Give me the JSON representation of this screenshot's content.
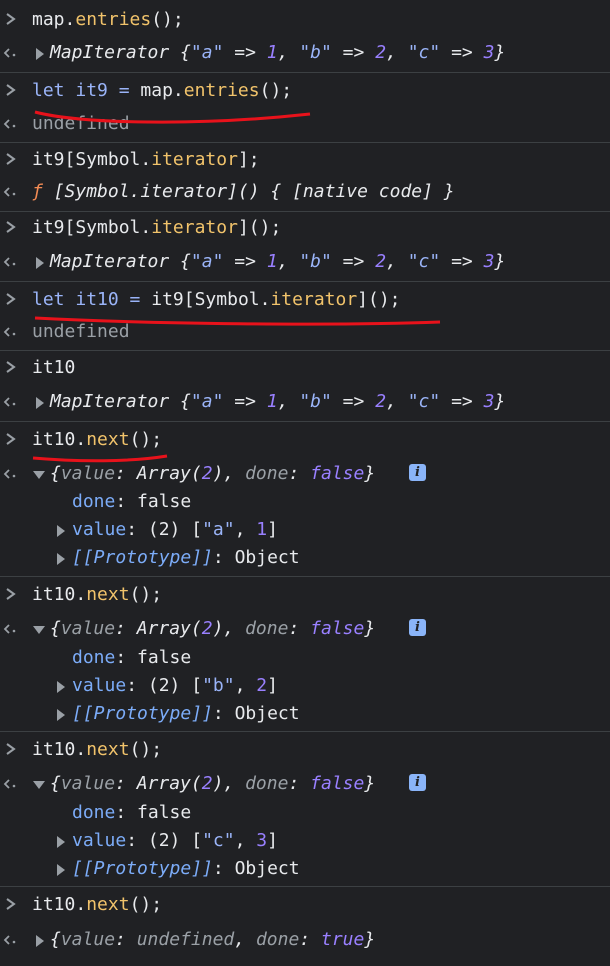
{
  "console": {
    "entries": [
      {
        "input": "map.entries();",
        "output": "MapIterator {\"a\" => 1, \"b\" => 2, \"c\" => 3}"
      },
      {
        "input": "let it9 = map.entries();",
        "output": "undefined"
      },
      {
        "input": "it9[Symbol.iterator];",
        "output": "ƒ [Symbol.iterator]() { [native code] }"
      },
      {
        "input": "it9[Symbol.iterator]();",
        "output": "MapIterator {\"a\" => 1, \"b\" => 2, \"c\" => 3}"
      },
      {
        "input": "let it10 = it9[Symbol.iterator]();",
        "output": "undefined"
      },
      {
        "input": "it10",
        "output": "MapIterator {\"a\" => 1, \"b\" => 2, \"c\" => 3}"
      },
      {
        "input": "it10.next();",
        "output": "{value: Array(2), done: false}",
        "expanded": [
          "done: false",
          "value: (2) [\"a\", 1]",
          "[[Prototype]]: Object"
        ]
      },
      {
        "input": "it10.next();",
        "output": "{value: Array(2), done: false}",
        "expanded": [
          "done: false",
          "value: (2) [\"b\", 2]",
          "[[Prototype]]: Object"
        ]
      },
      {
        "input": "it10.next();",
        "output": "{value: Array(2), done: false}",
        "expanded": [
          "done: false",
          "value: (2) [\"c\", 3]",
          "[[Prototype]]: Object"
        ]
      },
      {
        "input": "it10.next();",
        "output": "{value: undefined, done: true}"
      }
    ],
    "info_glyph": "i",
    "colors": {
      "background": "#202124",
      "annotation": "#e8121b"
    }
  }
}
